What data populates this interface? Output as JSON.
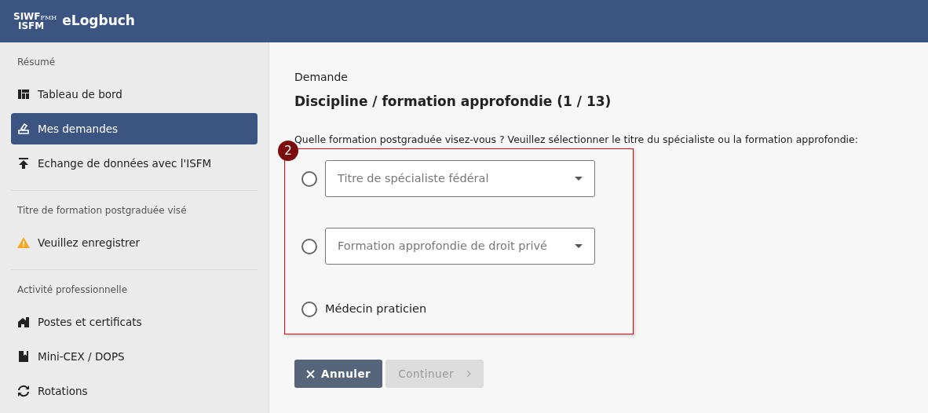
{
  "header": {
    "logo_top": "SIWF",
    "logo_small": "FMH",
    "logo_bottom": "ISFM",
    "app_name": "eLogbuch"
  },
  "sidebar": {
    "sections": [
      {
        "heading": "Résumé",
        "items": [
          {
            "kind": "link",
            "label": "Tableau de bord",
            "selected": false
          },
          {
            "kind": "link",
            "label": "Mes demandes",
            "selected": true
          },
          {
            "kind": "link",
            "label": "Echange de données avec l'ISFM",
            "selected": false
          }
        ]
      },
      {
        "heading": "Titre de formation postgraduée visé",
        "items": [
          {
            "kind": "warning",
            "label": "Veuillez enregistrer",
            "selected": false
          }
        ]
      },
      {
        "heading": "Activité professionnelle",
        "items": [
          {
            "kind": "link",
            "label": "Postes et certificats",
            "selected": false
          },
          {
            "kind": "link",
            "label": "Mini-CEX / DOPS",
            "selected": false
          },
          {
            "kind": "link",
            "label": "Rotations",
            "selected": false
          }
        ]
      }
    ]
  },
  "main": {
    "overline": "Demande",
    "title": "Discipline / formation approfondie (1 / 13)",
    "question": "Quelle formation postgraduée visez-vous ? Veuillez sélectionner le titre du spécialiste ou la formation approfondie:",
    "annotation": "2",
    "options": [
      {
        "kind": "select",
        "placeholder": "Titre de spécialiste fédéral",
        "selected": false
      },
      {
        "kind": "select",
        "placeholder": "Formation approfondie de droit privé",
        "selected": false
      },
      {
        "kind": "label",
        "label": "Médecin praticien",
        "selected": false
      }
    ],
    "buttons": [
      {
        "kind": "cancel",
        "label": "Annuler",
        "disabled": false
      },
      {
        "kind": "next",
        "label": "Continuer",
        "disabled": true
      }
    ]
  }
}
